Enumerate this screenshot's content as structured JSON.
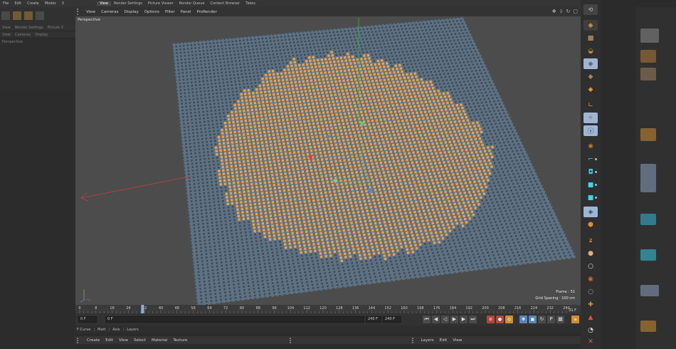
{
  "top_menu": [
    "File",
    "Edit",
    "Create",
    "Modes",
    "S",
    "View",
    "Render Settings",
    "Picture Viewer",
    "Render Queue",
    "Content Browser",
    "Takes"
  ],
  "left_panel": {
    "menu1": [
      "View",
      "Render Settings",
      "Picture V"
    ],
    "menu2": [
      "View",
      "Cameras",
      "Display"
    ],
    "camera_label": "Perspective"
  },
  "viewport": {
    "menu": [
      "View",
      "Cameras",
      "Display",
      "Options",
      "Filter",
      "Panel",
      "ProRender"
    ],
    "camera_label": "Perspective",
    "frame_text": "Frame : 51",
    "grid_spacing_text": "Grid Spacing : 100 cm",
    "nav_icons": [
      "move-view-icon",
      "move-down-icon",
      "rotate-view-icon",
      "maximize-icon"
    ],
    "colors": {
      "plane": "#5e7182",
      "dot_default": "#3f4c58",
      "dot_selected": "#e8a250",
      "background": "#4c4c4c"
    }
  },
  "timeline": {
    "ticks": [
      "0",
      "8",
      "16",
      "24",
      "32",
      "40",
      "48",
      "56",
      "64",
      "72",
      "80",
      "88",
      "96",
      "104",
      "112",
      "120",
      "128",
      "136",
      "144",
      "152",
      "160",
      "168",
      "176",
      "184",
      "192",
      "200",
      "208",
      "216",
      "224",
      "232",
      "240"
    ],
    "current_frame": 31,
    "max_frame": 240,
    "end_label": "31 F"
  },
  "transport": {
    "start_field": "0 F",
    "current_field": "0 F",
    "end_field": "240 F",
    "max_field": "240 F",
    "buttons": [
      "go-start-icon",
      "prev-key-icon",
      "play-back-icon",
      "play-icon",
      "next-key-icon",
      "go-end-icon"
    ],
    "record_buttons": [
      "record-icon",
      "auto-key-icon",
      "keyframe-selection-icon"
    ],
    "key_buttons": [
      "key-position-icon",
      "key-scale-icon",
      "key-rotation-icon",
      "key-param-icon",
      "key-pla-icon"
    ]
  },
  "tabs": [
    "F-Curve",
    "Matt",
    "Axis",
    "Layers"
  ],
  "bottom_menu_left": [
    "Create",
    "Edit",
    "View",
    "Select",
    "Material",
    "Texture"
  ],
  "bottom_menu_right": [
    "Layers",
    "Edit",
    "View"
  ],
  "right_toolbar_icons": [
    "undo-view-icon",
    "cube-icon",
    "checker-icon",
    "torus-icon",
    "cube-selected-icon",
    "cube-alt-icon",
    "cube-orange-icon",
    "axis-icon",
    "scatter-icon",
    "sphere-s-icon",
    "knot-icon",
    "spline-icon",
    "blue-cube-icon",
    "cyan-cube-icon",
    "cyan-cube-2-icon",
    "plane-icon",
    "polygon-icon",
    "deformer-icon",
    "sphere-icon",
    "light-icon",
    "target-icon",
    "null-icon",
    "triangle-icon",
    "cone-icon",
    "close-icon"
  ]
}
